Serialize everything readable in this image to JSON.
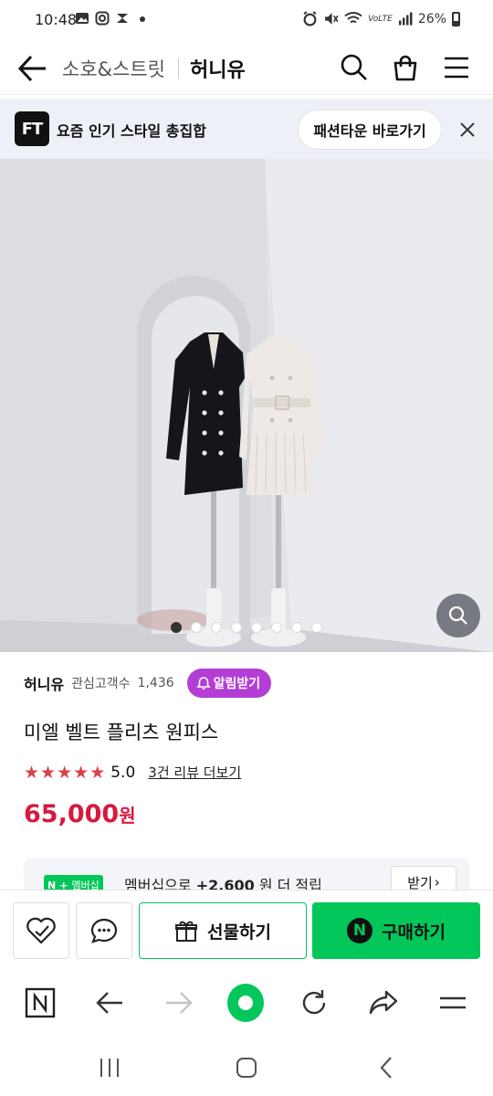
{
  "status_bar": {
    "time": "10:48",
    "left_icons": [
      "image-icon",
      "instagram-icon",
      "mail-icon",
      "dot-icon"
    ],
    "right_icons": [
      "alarm-icon",
      "mute-icon",
      "wifi-icon",
      "volte-icon",
      "signal-icon"
    ],
    "battery_text": "26%",
    "volte_label": "VoLTE"
  },
  "header": {
    "category": "소호&스트릿",
    "shop_name": "허니유",
    "icons": [
      "back-arrow-icon",
      "search-icon",
      "cart-icon",
      "menu-icon"
    ]
  },
  "banner": {
    "logo_text": "FT",
    "text": "요즘 인기 스타일 총집합",
    "button_label": "패션타운 바로가기"
  },
  "gallery": {
    "image_count": 8,
    "active_index": 0
  },
  "store": {
    "name": "허니유",
    "follower_label": "관심고객수",
    "follower_count": "1,436",
    "alarm_button": "알림받기"
  },
  "product": {
    "title": "미엘 벨트 플리츠 원피스",
    "rating": "5.0",
    "stars": 5,
    "review_link": "3건 리뷰 더보기",
    "price": "65,000",
    "price_unit": "원"
  },
  "membership": {
    "badge_n": "N",
    "badge_plus": "+",
    "badge_text": "멤버십",
    "text_prefix": "멤버십으로",
    "points": "+2,600",
    "text_suffix": "원 더 적립",
    "button": "받기",
    "button_chevron": "›"
  },
  "purchase_bar": {
    "gift_label": "선물하기",
    "buy_label": "구매하기",
    "buy_logo": "N"
  },
  "colors": {
    "accent_green": "#03c75a",
    "price_red": "#d6193e",
    "alarm_purple": "#b33ed6",
    "star_red": "#d8434a"
  }
}
